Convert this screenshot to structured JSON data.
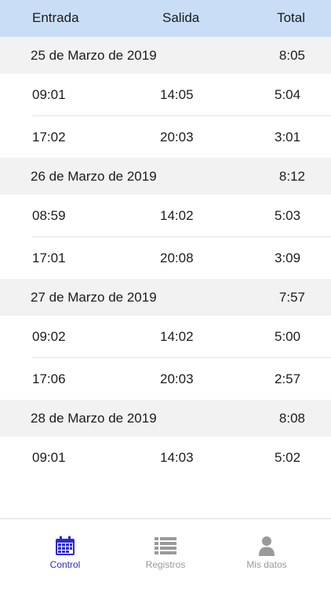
{
  "header": {
    "entrada": "Entrada",
    "salida": "Salida",
    "total": "Total"
  },
  "days": [
    {
      "date": "25 de Marzo de 2019",
      "total": "8:05",
      "rows": [
        {
          "in": "09:01",
          "out": "14:05",
          "total": "5:04"
        },
        {
          "in": "17:02",
          "out": "20:03",
          "total": "3:01"
        }
      ]
    },
    {
      "date": "26 de Marzo de 2019",
      "total": "8:12",
      "rows": [
        {
          "in": "08:59",
          "out": "14:02",
          "total": "5:03"
        },
        {
          "in": "17:01",
          "out": "20:08",
          "total": "3:09"
        }
      ]
    },
    {
      "date": "27 de Marzo de 2019",
      "total": "7:57",
      "rows": [
        {
          "in": "09:02",
          "out": "14:02",
          "total": "5:00"
        },
        {
          "in": "17:06",
          "out": "20:03",
          "total": "2:57"
        }
      ]
    },
    {
      "date": "28 de Marzo de 2019",
      "total": "8:08",
      "rows": [
        {
          "in": "09:01",
          "out": "14:03",
          "total": "5:02"
        }
      ]
    }
  ],
  "tabs": [
    {
      "label": "Control",
      "icon": "calendar-icon",
      "active": true
    },
    {
      "label": "Registros",
      "icon": "list-icon",
      "active": false
    },
    {
      "label": "Mis datos",
      "icon": "user-icon",
      "active": false
    }
  ],
  "colors": {
    "header_bg": "#c9def6",
    "day_bg": "#f2f2f2",
    "active": "#2d2ad0",
    "inactive": "#9a9a9a"
  }
}
